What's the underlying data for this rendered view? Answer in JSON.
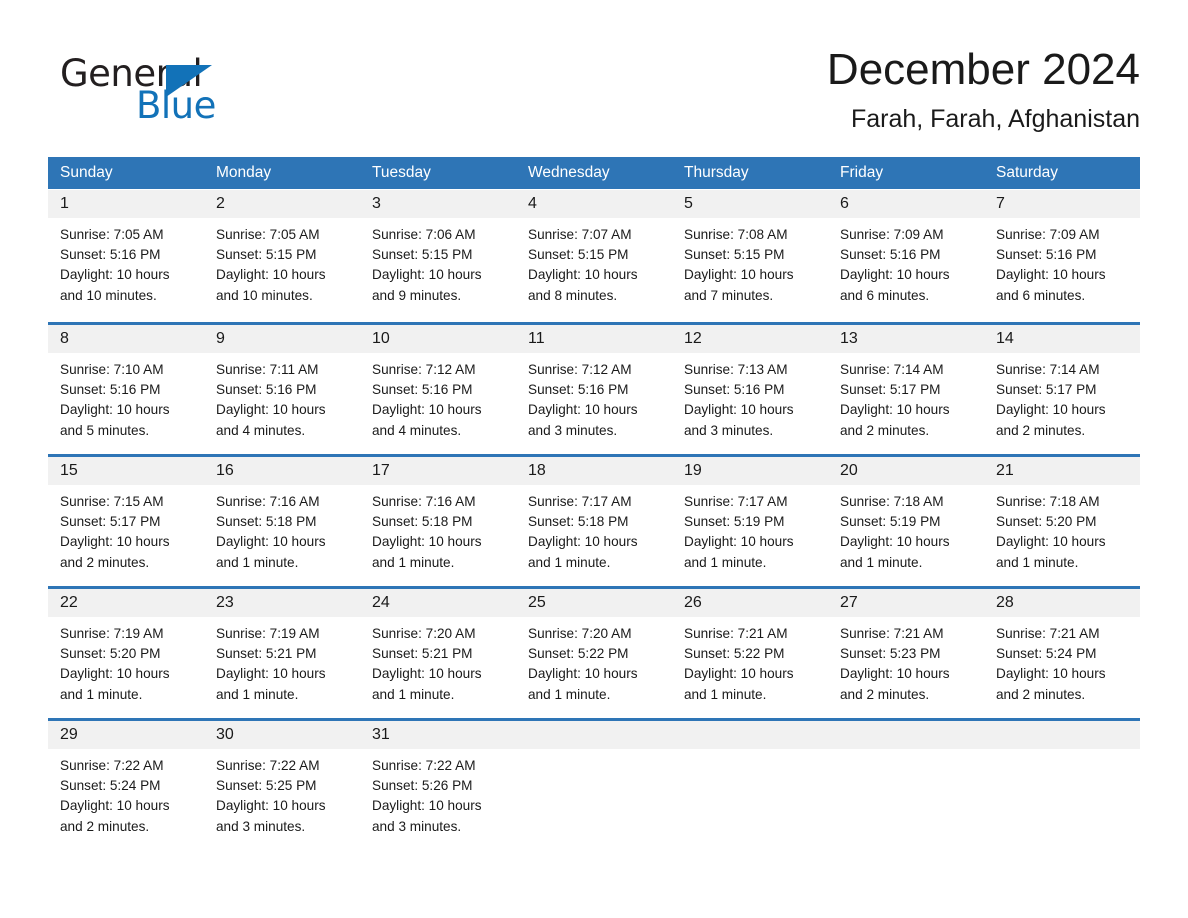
{
  "brand": {
    "name_part1": "General",
    "name_part2": "Blue",
    "logo_icon": "triangle-flag-icon",
    "accent_color": "#1272b8"
  },
  "header": {
    "month_title": "December 2024",
    "location": "Farah, Farah, Afghanistan"
  },
  "calendar": {
    "header_bg": "#2e75b6",
    "row_divider_color": "#2e75b6",
    "day_band_bg": "#f1f1f1",
    "weekdays": [
      "Sunday",
      "Monday",
      "Tuesday",
      "Wednesday",
      "Thursday",
      "Friday",
      "Saturday"
    ],
    "weeks": [
      {
        "days": [
          {
            "date": "1",
            "sunrise": "Sunrise: 7:05 AM",
            "sunset": "Sunset: 5:16 PM",
            "daylight": "Daylight: 10 hours and 10 minutes."
          },
          {
            "date": "2",
            "sunrise": "Sunrise: 7:05 AM",
            "sunset": "Sunset: 5:15 PM",
            "daylight": "Daylight: 10 hours and 10 minutes."
          },
          {
            "date": "3",
            "sunrise": "Sunrise: 7:06 AM",
            "sunset": "Sunset: 5:15 PM",
            "daylight": "Daylight: 10 hours and 9 minutes."
          },
          {
            "date": "4",
            "sunrise": "Sunrise: 7:07 AM",
            "sunset": "Sunset: 5:15 PM",
            "daylight": "Daylight: 10 hours and 8 minutes."
          },
          {
            "date": "5",
            "sunrise": "Sunrise: 7:08 AM",
            "sunset": "Sunset: 5:15 PM",
            "daylight": "Daylight: 10 hours and 7 minutes."
          },
          {
            "date": "6",
            "sunrise": "Sunrise: 7:09 AM",
            "sunset": "Sunset: 5:16 PM",
            "daylight": "Daylight: 10 hours and 6 minutes."
          },
          {
            "date": "7",
            "sunrise": "Sunrise: 7:09 AM",
            "sunset": "Sunset: 5:16 PM",
            "daylight": "Daylight: 10 hours and 6 minutes."
          }
        ]
      },
      {
        "days": [
          {
            "date": "8",
            "sunrise": "Sunrise: 7:10 AM",
            "sunset": "Sunset: 5:16 PM",
            "daylight": "Daylight: 10 hours and 5 minutes."
          },
          {
            "date": "9",
            "sunrise": "Sunrise: 7:11 AM",
            "sunset": "Sunset: 5:16 PM",
            "daylight": "Daylight: 10 hours and 4 minutes."
          },
          {
            "date": "10",
            "sunrise": "Sunrise: 7:12 AM",
            "sunset": "Sunset: 5:16 PM",
            "daylight": "Daylight: 10 hours and 4 minutes."
          },
          {
            "date": "11",
            "sunrise": "Sunrise: 7:12 AM",
            "sunset": "Sunset: 5:16 PM",
            "daylight": "Daylight: 10 hours and 3 minutes."
          },
          {
            "date": "12",
            "sunrise": "Sunrise: 7:13 AM",
            "sunset": "Sunset: 5:16 PM",
            "daylight": "Daylight: 10 hours and 3 minutes."
          },
          {
            "date": "13",
            "sunrise": "Sunrise: 7:14 AM",
            "sunset": "Sunset: 5:17 PM",
            "daylight": "Daylight: 10 hours and 2 minutes."
          },
          {
            "date": "14",
            "sunrise": "Sunrise: 7:14 AM",
            "sunset": "Sunset: 5:17 PM",
            "daylight": "Daylight: 10 hours and 2 minutes."
          }
        ]
      },
      {
        "days": [
          {
            "date": "15",
            "sunrise": "Sunrise: 7:15 AM",
            "sunset": "Sunset: 5:17 PM",
            "daylight": "Daylight: 10 hours and 2 minutes."
          },
          {
            "date": "16",
            "sunrise": "Sunrise: 7:16 AM",
            "sunset": "Sunset: 5:18 PM",
            "daylight": "Daylight: 10 hours and 1 minute."
          },
          {
            "date": "17",
            "sunrise": "Sunrise: 7:16 AM",
            "sunset": "Sunset: 5:18 PM",
            "daylight": "Daylight: 10 hours and 1 minute."
          },
          {
            "date": "18",
            "sunrise": "Sunrise: 7:17 AM",
            "sunset": "Sunset: 5:18 PM",
            "daylight": "Daylight: 10 hours and 1 minute."
          },
          {
            "date": "19",
            "sunrise": "Sunrise: 7:17 AM",
            "sunset": "Sunset: 5:19 PM",
            "daylight": "Daylight: 10 hours and 1 minute."
          },
          {
            "date": "20",
            "sunrise": "Sunrise: 7:18 AM",
            "sunset": "Sunset: 5:19 PM",
            "daylight": "Daylight: 10 hours and 1 minute."
          },
          {
            "date": "21",
            "sunrise": "Sunrise: 7:18 AM",
            "sunset": "Sunset: 5:20 PM",
            "daylight": "Daylight: 10 hours and 1 minute."
          }
        ]
      },
      {
        "days": [
          {
            "date": "22",
            "sunrise": "Sunrise: 7:19 AM",
            "sunset": "Sunset: 5:20 PM",
            "daylight": "Daylight: 10 hours and 1 minute."
          },
          {
            "date": "23",
            "sunrise": "Sunrise: 7:19 AM",
            "sunset": "Sunset: 5:21 PM",
            "daylight": "Daylight: 10 hours and 1 minute."
          },
          {
            "date": "24",
            "sunrise": "Sunrise: 7:20 AM",
            "sunset": "Sunset: 5:21 PM",
            "daylight": "Daylight: 10 hours and 1 minute."
          },
          {
            "date": "25",
            "sunrise": "Sunrise: 7:20 AM",
            "sunset": "Sunset: 5:22 PM",
            "daylight": "Daylight: 10 hours and 1 minute."
          },
          {
            "date": "26",
            "sunrise": "Sunrise: 7:21 AM",
            "sunset": "Sunset: 5:22 PM",
            "daylight": "Daylight: 10 hours and 1 minute."
          },
          {
            "date": "27",
            "sunrise": "Sunrise: 7:21 AM",
            "sunset": "Sunset: 5:23 PM",
            "daylight": "Daylight: 10 hours and 2 minutes."
          },
          {
            "date": "28",
            "sunrise": "Sunrise: 7:21 AM",
            "sunset": "Sunset: 5:24 PM",
            "daylight": "Daylight: 10 hours and 2 minutes."
          }
        ]
      },
      {
        "days": [
          {
            "date": "29",
            "sunrise": "Sunrise: 7:22 AM",
            "sunset": "Sunset: 5:24 PM",
            "daylight": "Daylight: 10 hours and 2 minutes."
          },
          {
            "date": "30",
            "sunrise": "Sunrise: 7:22 AM",
            "sunset": "Sunset: 5:25 PM",
            "daylight": "Daylight: 10 hours and 3 minutes."
          },
          {
            "date": "31",
            "sunrise": "Sunrise: 7:22 AM",
            "sunset": "Sunset: 5:26 PM",
            "daylight": "Daylight: 10 hours and 3 minutes."
          },
          {
            "date": "",
            "sunrise": "",
            "sunset": "",
            "daylight": ""
          },
          {
            "date": "",
            "sunrise": "",
            "sunset": "",
            "daylight": ""
          },
          {
            "date": "",
            "sunrise": "",
            "sunset": "",
            "daylight": ""
          },
          {
            "date": "",
            "sunrise": "",
            "sunset": "",
            "daylight": ""
          }
        ]
      }
    ]
  }
}
